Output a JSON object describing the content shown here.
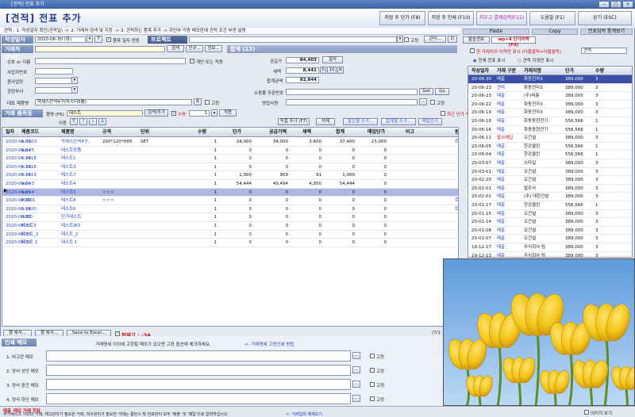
{
  "window": {
    "title": "[견적] 전표 추가",
    "page_title": "[견적] 전표 추가"
  },
  "toolbar": {
    "save_print": "저장 후 단가 (F8)",
    "save_continue": "저장 후 인쇄 (F10)",
    "save_pay": "지우고 결제입력(F11)",
    "help": "도움말 (F1)",
    "close": "닫기 (ESC)",
    "paste": "Paste",
    "copy": "Copy",
    "fullscreen": "전표입력 통계보기"
  },
  "route_text": "견적 : 1. 작성일자 확인(견적일) -> 2. 거래처 검색 및 지정 -> 3. 견적하는 품목 추가 -> 하단부 각종 메모란에 견적 조건 부연 설명",
  "form": {
    "date_label": "작성일자",
    "date_value": "2020-06-30 (화)",
    "date_T": "T",
    "date_check": "품목 일자 연동",
    "project_label": "프로젝트",
    "client_label": "거래처 (F4)",
    "client_search": "검색",
    "client_new": "신규...",
    "client_info": "정보...",
    "name_label": "상호 or 이름",
    "name_check": "개인 또는 직원",
    "bizno_label": "사업자번호",
    "dept_label": "종사업장",
    "dept2_label": "관련부서",
    "rep_item_label": "대표 제품명",
    "rep_item_value": "약세스산석4구(마스터5를)",
    "rep_btn": "B",
    "rep_fix": "고정",
    "fix_label": "고정",
    "manage_label": "관리...",
    "d_label": "D",
    "summary_label": "합계 (13)",
    "supply_label": "공급가",
    "supply_value": "84,403",
    "reg_btn": "절사",
    "tax_label": "세액",
    "tax_value": "8,441",
    "tax_0": "0",
    "tax_10": "10",
    "tax_R": "R",
    "total_label": "합계금액",
    "total_value": "92,844",
    "shop_label": "쇼핑몰 주문번호",
    "shop_get": "Get",
    "shop_go": "Go",
    "sales_label": "영업사원"
  },
  "items": {
    "section_label": "거래 품목등",
    "name_label": "품명 (F6)",
    "name_value": "테스트",
    "search_add": "검색/추가",
    "amount_label": "수량",
    "amount_value": "1",
    "apply": "적용",
    "last_price": "최근 단가 적용",
    "move_label": "이동",
    "direct_add": "직접 추가 (F7)",
    "delete": "삭제",
    "discount": "할인행 추가...",
    "total_row": "합계행 추가...",
    "unit_price": "매입단가"
  },
  "grid": {
    "headers": [
      "일자",
      "제품코드",
      "제품명",
      "규격",
      "단위",
      "수량",
      "단가",
      "공급가액",
      "세액",
      "합계",
      "매입단가",
      "비고",
      "원"
    ],
    "rows": [
      [
        "2020-06-30",
        "a.0103",
        "약세스산석4구..",
        "200*120*H85",
        "SET",
        "1",
        "34,000",
        "34,000",
        "3,400",
        "37,400",
        "23,000",
        "",
        "트"
      ],
      [
        "2020-06-30",
        "wp+5",
        "테스트장품",
        "",
        "",
        "1",
        "0",
        "0",
        "0",
        "0",
        "0",
        "",
        ""
      ],
      [
        "2020-06-30",
        "c.1418",
        "테스트1",
        "",
        "",
        "1",
        "0",
        "0",
        "0",
        "0",
        "0",
        "",
        ""
      ],
      [
        "2020-06-30",
        "c.1418",
        "테스트3",
        "",
        "",
        "1",
        "0",
        "0",
        "0",
        "0",
        "0",
        "",
        ""
      ],
      [
        "2020-06-30",
        "c.1419",
        "테스트7",
        "",
        "",
        "1",
        "1,000",
        "909",
        "91",
        "1,000",
        "0",
        "",
        ""
      ],
      [
        "2020-06-30",
        "wp+3",
        "테스트4",
        "",
        "",
        "1",
        "54,444",
        "49,494",
        "4,950",
        "54,444",
        "0",
        "",
        ""
      ],
      [
        "2020-06-30",
        "wp+4",
        "테스트5",
        "☆☆☆",
        "",
        "1",
        "0",
        "0",
        "0",
        "0",
        "0",
        "",
        ""
      ],
      [
        "2020-06-30",
        "P0001",
        "테스트8",
        "☆☆☆",
        "",
        "1",
        "0",
        "0",
        "0",
        "0",
        "0",
        "",
        "트"
      ],
      [
        "2020-06-30",
        "c.1420",
        "테스트6",
        "",
        "",
        "1",
        "0",
        "0",
        "0",
        "0",
        "0",
        "",
        "트"
      ],
      [
        "2020-06-30",
        "0000",
        "단가테스트",
        "",
        "",
        "1",
        "0",
        "0",
        "0",
        "0",
        "0",
        "",
        ""
      ],
      [
        "2020-06-30",
        "테스트3",
        "테스트W3",
        "",
        "",
        "1",
        "0",
        "0",
        "0",
        "0",
        "0",
        "",
        ""
      ],
      [
        "2020-06-30",
        "테스트_2",
        "테스트_2",
        "",
        "",
        "1",
        "0",
        "0",
        "0",
        "0",
        "0",
        "",
        ""
      ],
      [
        "2020-06-30",
        "테스트 1",
        "테스트 1",
        "",
        "",
        "1",
        "0",
        "0",
        "0",
        "0",
        "0",
        "",
        ""
      ]
    ]
  },
  "grid_footer": {
    "btn1": "행 복사...",
    "btn2": "행 복사...",
    "excel": "Save to Excel...",
    "current_label": "현재고 : -34",
    "page": "(7/1"
  },
  "memo": {
    "section_label": "인쇄 메모",
    "notice": "거래명세 이외에 고정될 메모가 있으면 고정 옵션에 체크하세요.",
    "link": "<- 거래명세 고정인쇄 방법",
    "lines": [
      {
        "label": "1. 비고란 메모",
        "fix": "고정"
      },
      {
        "label": "2. 양식 상단 메모",
        "fix": "고정"
      },
      {
        "label": "3. 양식 중간 메모",
        "fix": "고정"
      },
      {
        "label": "4. 양식 하단 메모",
        "fix": "고정"
      }
    ]
  },
  "status": {
    "linked_label": "매출_매입 거래 전표",
    "desc": "부가세시고 이외의 거래, 재고관리가 필요한 거래, 미수관리가 필요한 거래는 통번시 맞 전표만이 모두 '매출' 및 '매입'으로 입력하십시오.",
    "link": "<- 거래입력 예제보기",
    "image_view": "이미지 보기"
  },
  "right": {
    "tab1": "발송정보",
    "tab2": "wp+4 단가이력 (F9)",
    "filter_check": "현 거래처의 이력만 표시 (더블클릭=더블클릭)",
    "filter_value": "견적",
    "radio1": "전체 전표 표시",
    "radio2": "견적 지정만 표시",
    "headers": [
      "작성일자",
      "거래 구분",
      "거래처명",
      "단가",
      "수량"
    ],
    "rows": [
      [
        "20-06-30",
        "매출",
        "화동전자3",
        "389,000",
        "3"
      ],
      [
        "20-06-23",
        "견적",
        "화동전자3",
        "389,000",
        "3"
      ],
      [
        "20-06-23",
        "매출",
        "(주)비층",
        "389,000",
        "3"
      ],
      [
        "20-06-22",
        "매출",
        "화동전자3",
        "389,000",
        "3"
      ],
      [
        "20-06-19",
        "매출",
        "화동전자3",
        "389,000",
        "3"
      ],
      [
        "20-06-18",
        "매출",
        "화동동현전기",
        "556,566",
        "1"
      ],
      [
        "20-06-16",
        "매출",
        "화동동현전기",
        "556,566",
        "1"
      ],
      [
        "20-06-11",
        "할소매입",
        "오건설",
        "389,000",
        "3"
      ],
      [
        "20-06-05",
        "매출",
        "한강클린",
        "556,566",
        "1"
      ],
      [
        "20-06-04",
        "매출",
        "한강클린",
        "556,566",
        "1"
      ],
      [
        "20-03-07",
        "매출",
        "스타일",
        "389,000",
        "3"
      ],
      [
        "20-03-01",
        "매출",
        "오건설",
        "389,000",
        "3"
      ],
      [
        "20-02-20",
        "매출",
        "오건설",
        "389,000",
        "3"
      ],
      [
        "20-02-01",
        "매출",
        "발주사",
        "389,000",
        "3"
      ],
      [
        "20-02-01",
        "매출",
        "(주) 대한건설",
        "389,000",
        "3"
      ],
      [
        "20-01-17",
        "매출",
        "한강클린",
        "556,566",
        "1"
      ],
      [
        "20-01-15",
        "매출",
        "오건설",
        "389,000",
        "3"
      ],
      [
        "20-01-14",
        "매출",
        "오건설",
        "389,000",
        "3"
      ],
      [
        "20-01-08",
        "매출",
        "오건설",
        "389,000",
        "3"
      ],
      [
        "20-01-07",
        "매출",
        "오건설",
        "389,000",
        "3"
      ],
      [
        "19-12-17",
        "매출",
        "주식회사 팀",
        "389,000",
        "3"
      ],
      [
        "19-12-13",
        "매출",
        "주식회사 팀",
        "389,000",
        "3"
      ]
    ]
  },
  "photo": {
    "sky_color": "#7fb3e6",
    "petal_color": "#f2c51a",
    "stem_color": "#5f8c2b"
  }
}
